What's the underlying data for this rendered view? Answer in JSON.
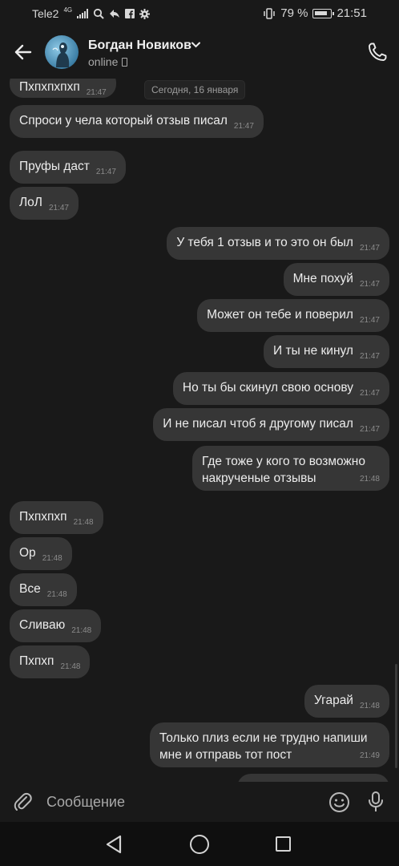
{
  "status_bar": {
    "carrier": "Tele2",
    "network": "4G",
    "battery_percent": "79 %",
    "time": "21:51"
  },
  "header": {
    "contact_name": "Богдан Новиков",
    "status": "online"
  },
  "date_separator": "Сегодня, 16 января",
  "messages": [
    {
      "text": "Пхпхпхпхп",
      "time": "21:47",
      "side": "in"
    },
    {
      "text": "Спроси у чела который отзыв писал",
      "time": "21:47",
      "side": "in"
    },
    {
      "text": "Пруфы даст",
      "time": "21:47",
      "side": "in"
    },
    {
      "text": "ЛоЛ",
      "time": "21:47",
      "side": "in"
    },
    {
      "text": "У тебя 1 отзыв и то это он был",
      "time": "21:47",
      "side": "out"
    },
    {
      "text": "Мне похуй",
      "time": "21:47",
      "side": "out"
    },
    {
      "text": "Может он тебе и поверил",
      "time": "21:47",
      "side": "out"
    },
    {
      "text": "И ты не кинул",
      "time": "21:47",
      "side": "out"
    },
    {
      "text": "Но ты бы скинул свою основу",
      "time": "21:47",
      "side": "out"
    },
    {
      "text": "И не писал чтоб я другому писал",
      "time": "21:47",
      "side": "out"
    },
    {
      "text_line1": "Где тоже у кого то возможно",
      "text_line2": "накрученые отзывы",
      "time": "21:48",
      "side": "out"
    },
    {
      "text": "Пхпхпхп",
      "time": "21:48",
      "side": "in"
    },
    {
      "text": "Ор",
      "time": "21:48",
      "side": "in"
    },
    {
      "text": "Все",
      "time": "21:48",
      "side": "in"
    },
    {
      "text": "Сливаю",
      "time": "21:48",
      "side": "in"
    },
    {
      "text": "Пхпхп",
      "time": "21:48",
      "side": "in"
    },
    {
      "text": "Угарай",
      "time": "21:48",
      "side": "out"
    },
    {
      "text_line1": "Только плиз если не трудно напиши",
      "text_line2": "мне и отправь тот пост",
      "time": "21:49",
      "side": "out"
    }
  ],
  "composer": {
    "placeholder": "Сообщение"
  },
  "colors": {
    "background": "#191919",
    "bubble": "#363636",
    "navbar": "#0f0f0f"
  },
  "icons": [
    "back-arrow-icon",
    "phone-icon",
    "paperclip-icon",
    "emoji-icon",
    "microphone-icon"
  ]
}
